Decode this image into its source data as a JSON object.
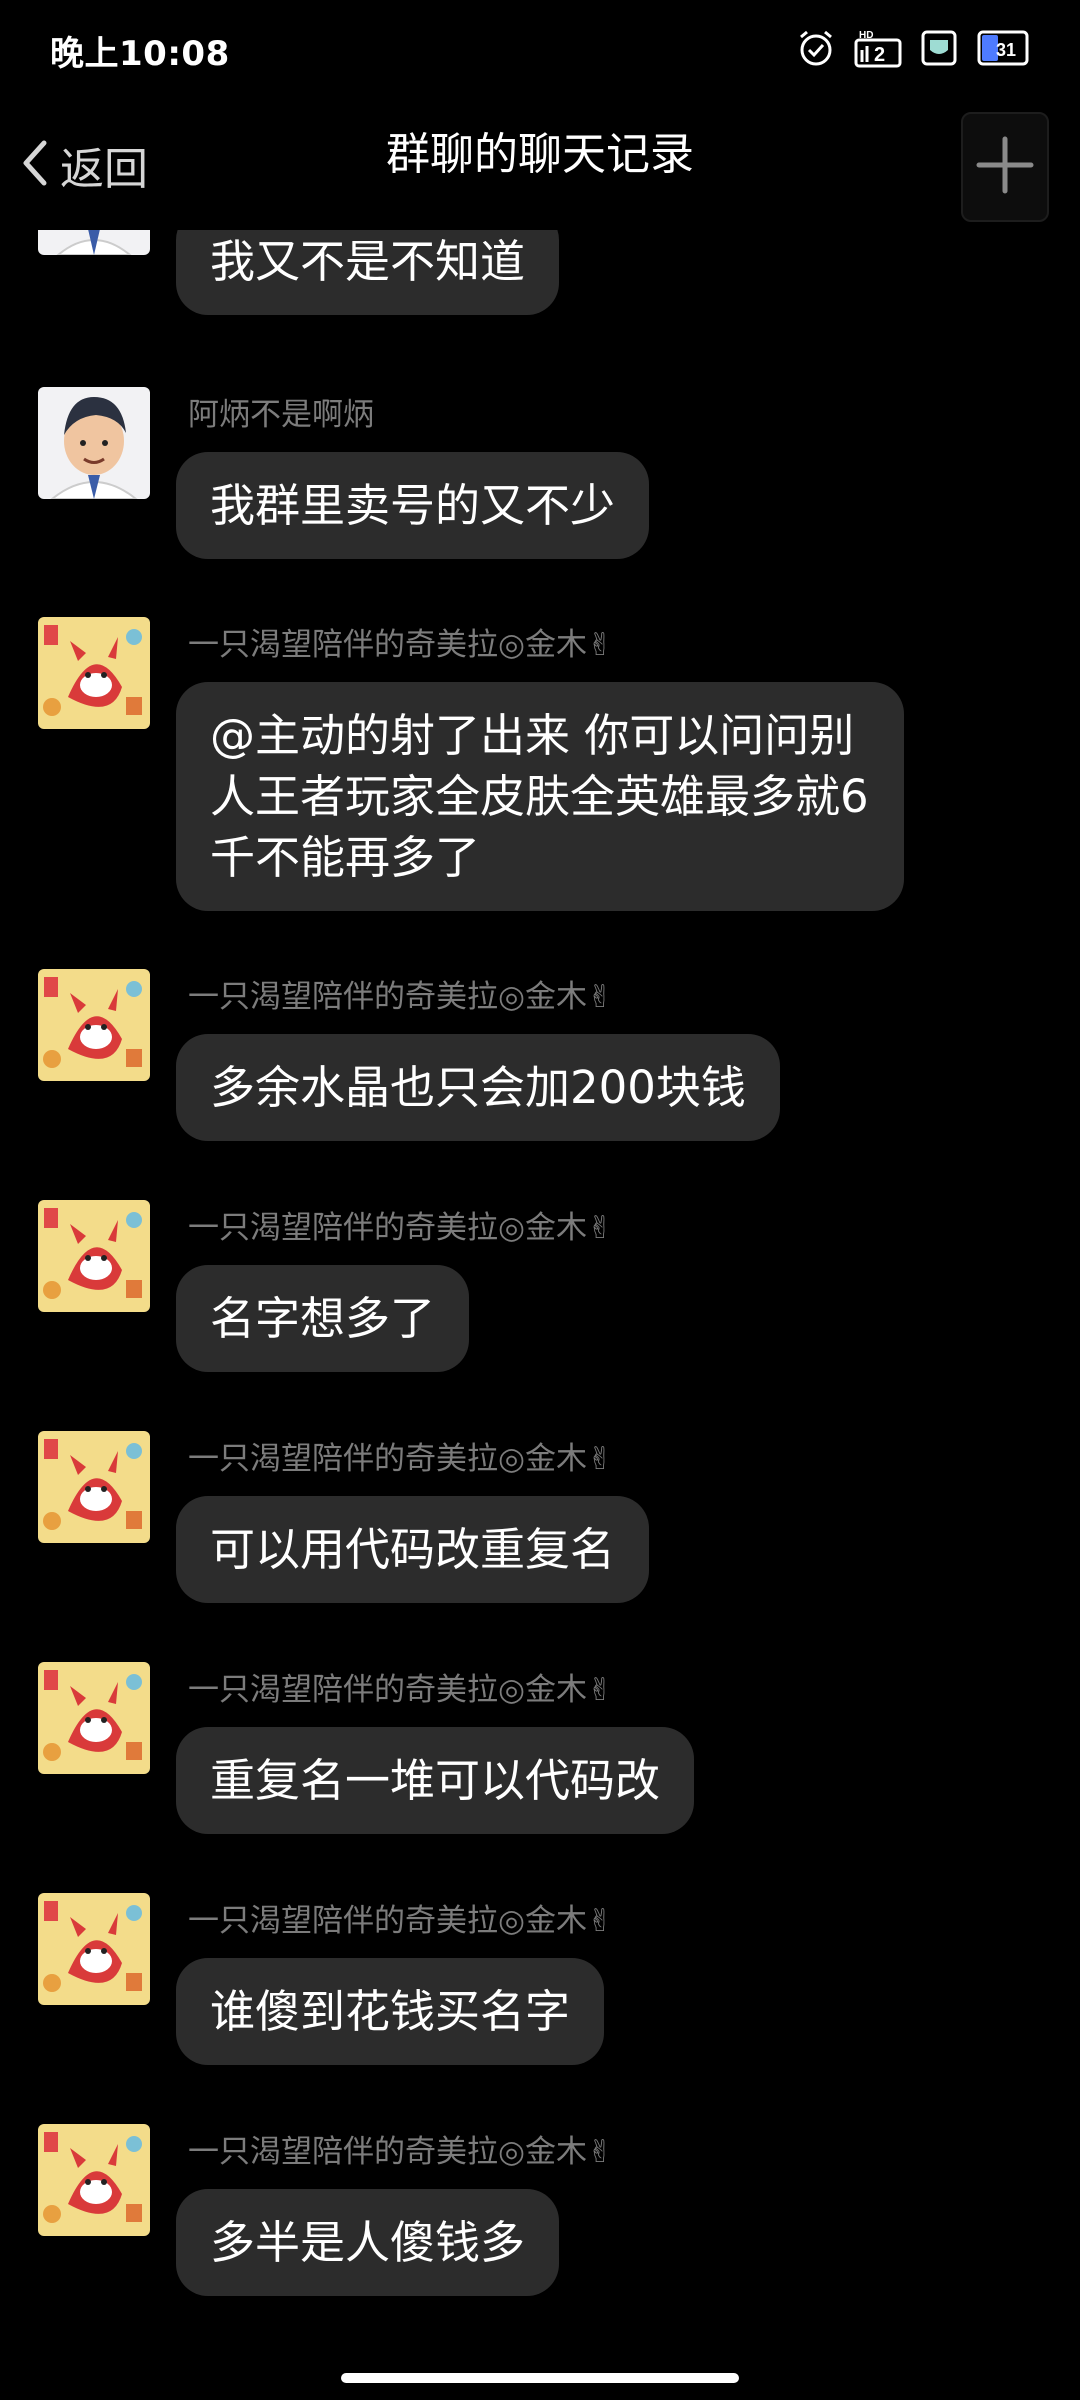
{
  "status_bar": {
    "time": "晚上10:08",
    "icons": [
      "alarm-icon",
      "hd-signal-icon",
      "shield-icon",
      "battery-icon"
    ],
    "battery_level": "31"
  },
  "header": {
    "back_label": "返回",
    "title": "群聊的聊天记录",
    "plus_icon": "plus-icon"
  },
  "messages": [
    {
      "sender": "",
      "avatar": "man-avatar",
      "text": "我又不是不知道"
    },
    {
      "sender": "阿炳不是啊炳",
      "avatar": "man-avatar",
      "text": "我群里卖号的又不少"
    },
    {
      "sender": "一只渴望陪伴的奇美拉◎金木✌",
      "avatar": "fox-avatar",
      "text": "@主动的射了出来 你可以问问别人王者玩家全皮肤全英雄最多就6千不能再多了"
    },
    {
      "sender": "一只渴望陪伴的奇美拉◎金木✌",
      "avatar": "fox-avatar",
      "text": "多余水晶也只会加200块钱"
    },
    {
      "sender": "一只渴望陪伴的奇美拉◎金木✌",
      "avatar": "fox-avatar",
      "text": "名字想多了"
    },
    {
      "sender": "一只渴望陪伴的奇美拉◎金木✌",
      "avatar": "fox-avatar",
      "text": "可以用代码改重复名"
    },
    {
      "sender": "一只渴望陪伴的奇美拉◎金木✌",
      "avatar": "fox-avatar",
      "text": "重复名一堆可以代码改"
    },
    {
      "sender": "一只渴望陪伴的奇美拉◎金木✌",
      "avatar": "fox-avatar",
      "text": "谁傻到花钱买名字"
    },
    {
      "sender": "一只渴望陪伴的奇美拉◎金木✌",
      "avatar": "fox-avatar",
      "text": "多半是人傻钱多"
    }
  ],
  "colors": {
    "background": "#000000",
    "bubble": "#2c2c2c",
    "sender_text": "#7c7c7c",
    "text": "#ffffff"
  }
}
